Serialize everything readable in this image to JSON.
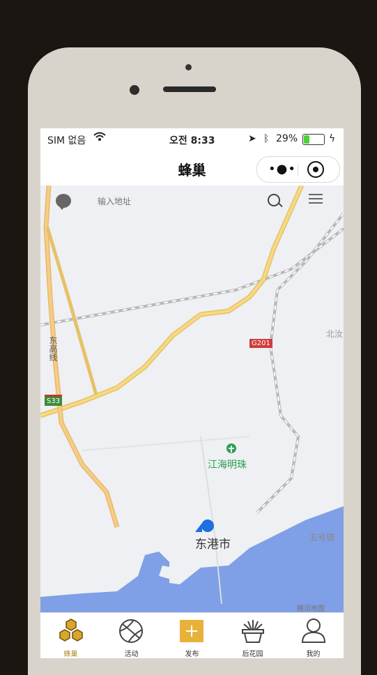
{
  "status_bar": {
    "carrier": "SIM 없음",
    "time": "오전 8:33",
    "battery_percent": "29%",
    "battery_level": 0.29
  },
  "nav": {
    "title": "蜂巢"
  },
  "search": {
    "placeholder": "输入地址"
  },
  "map": {
    "poi": "江海明珠",
    "city": "东港市",
    "town": "五号镇",
    "place_right": "北汝",
    "road_vertical": "东高线",
    "shield_s33": "S33",
    "shield_g201": "G201",
    "copyright": "腾讯地图"
  },
  "tabs": [
    {
      "label": "蜂巢",
      "icon": "honeycomb-icon",
      "active": true
    },
    {
      "label": "活动",
      "icon": "ball-icon",
      "active": false
    },
    {
      "label": "发布",
      "icon": "add-post-icon",
      "active": false
    },
    {
      "label": "后花园",
      "icon": "plant-pot-icon",
      "active": false
    },
    {
      "label": "我的",
      "icon": "profile-icon",
      "active": false
    }
  ],
  "colors": {
    "accent": "#e8b23a",
    "map_water": "#7f9fe6",
    "map_highway": "#f1c95a",
    "map_road_orange": "#eebb66",
    "location_dot": "#1e6fe0",
    "poi_green": "#2aa050"
  }
}
